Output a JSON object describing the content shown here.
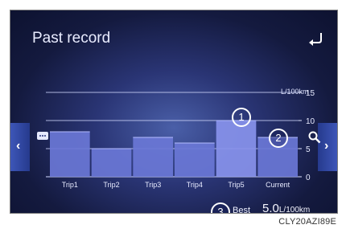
{
  "header": {
    "title": "Past record"
  },
  "chart_data": {
    "type": "bar",
    "unit_label": "L/100km",
    "categories": [
      "Trip1",
      "Trip2",
      "Trip3",
      "Trip4",
      "Trip5",
      "Current"
    ],
    "values": [
      8,
      5,
      7,
      6,
      10,
      7
    ],
    "y_ticks": [
      "0",
      "5",
      "10",
      "15"
    ],
    "ylim": [
      0,
      15
    ],
    "grid": true
  },
  "callouts": {
    "c1": "1",
    "c2": "2",
    "c3": "3"
  },
  "best": {
    "label": "Best",
    "value": "5.0",
    "unit": "L/100km"
  },
  "icons": {
    "back": "back-arrow-icon",
    "left": "chevron-left-icon",
    "right": "chevron-right-icon",
    "menu": "dots-icon",
    "zoom": "zoom-icon"
  },
  "colors": {
    "bar": "#6f7fdc",
    "bar_highlight": "#8b98f0",
    "background": "#141a3f"
  },
  "footer": {
    "code": "CLY20AZI89E"
  }
}
